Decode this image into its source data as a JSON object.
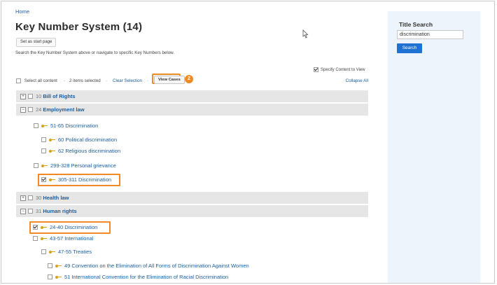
{
  "breadcrumb": "Home",
  "page_title": "Key Number System (14)",
  "start_button": "Set as start page",
  "description": "Search the Key Number System above or navigate to specific Key Numbers below.",
  "specify_label": "Specify Content to View",
  "toolbar": {
    "select_all": "Select all content",
    "items_selected": "2 items selected",
    "clear_selection": "Clear Selection",
    "view_cases": "View Cases",
    "badge": "2",
    "collapse_all": "Collapse All",
    "sep1": "·",
    "sep2": "·",
    "sep3": "·"
  },
  "tree": [
    {
      "num": "10",
      "title": "Bill of Rights",
      "expander": "+"
    },
    {
      "num": "24",
      "title": "Employment law",
      "expander": "−"
    },
    {
      "num": "51-65",
      "title": "Discrimination"
    },
    {
      "num": "60",
      "title": "Political discrimination"
    },
    {
      "num": "62",
      "title": "Religious discrimination"
    },
    {
      "num": "299-328",
      "title": "Personal grievance"
    },
    {
      "num": "305-311",
      "title": "Discrimination",
      "checked": true
    },
    {
      "num": "30",
      "title": "Health law",
      "expander": "+"
    },
    {
      "num": "31",
      "title": "Human rights",
      "expander": "−"
    },
    {
      "num": "24-40",
      "title": "Discrimination",
      "checked": true
    },
    {
      "num": "43-57",
      "title": "International"
    },
    {
      "num": "47-55",
      "title": "Treaties"
    },
    {
      "num": "49",
      "title": "Convention on the Elimination of All Forms of Discrimination Against Women"
    },
    {
      "num": "51",
      "title": "International Convention for the Elimination of Racial Discrimination"
    }
  ],
  "sidebar": {
    "title": "Title Search",
    "input_value": "discrimination",
    "search_button": "Search"
  },
  "colors": {
    "link": "#1a5d9a",
    "highlight": "#f08a24",
    "search_button": "#1f72d1",
    "sidebar_bg": "#eef4fb",
    "key_icon": "#d9a21b"
  }
}
